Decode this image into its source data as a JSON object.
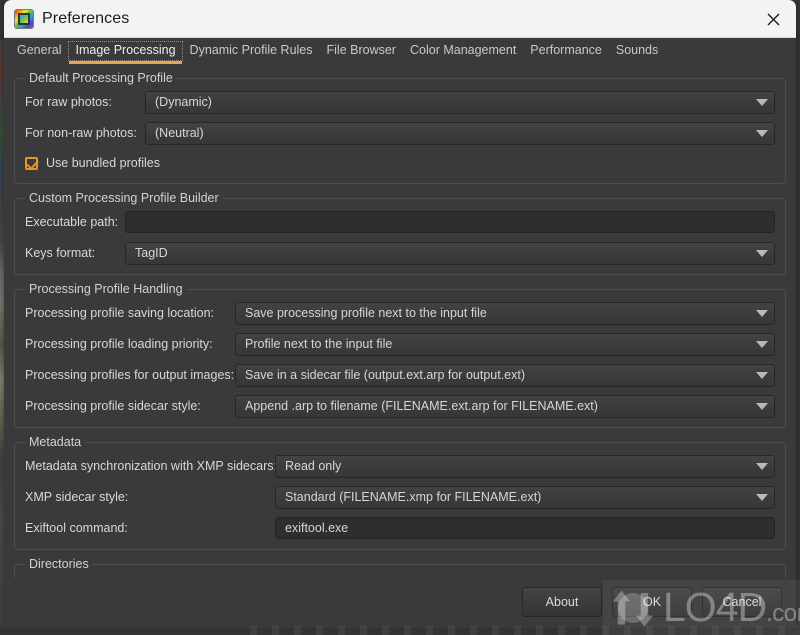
{
  "window": {
    "title": "Preferences",
    "app_icon": "rawtherapee-icon",
    "close_label": "close-icon"
  },
  "tabs": [
    {
      "label": "General",
      "active": false
    },
    {
      "label": "Image Processing",
      "active": true
    },
    {
      "label": "Dynamic Profile Rules",
      "active": false
    },
    {
      "label": "File Browser",
      "active": false
    },
    {
      "label": "Color Management",
      "active": false
    },
    {
      "label": "Performance",
      "active": false
    },
    {
      "label": "Sounds",
      "active": false
    }
  ],
  "groups": {
    "default_processing_profile": {
      "title": "Default Processing Profile",
      "raw_label": "For raw photos:",
      "raw_value": "(Dynamic)",
      "nonraw_label": "For non-raw photos:",
      "nonraw_value": "(Neutral)",
      "bundled_label": "Use bundled profiles",
      "bundled_checked": true
    },
    "custom_profile_builder": {
      "title": "Custom Processing Profile Builder",
      "exec_label": "Executable path:",
      "exec_value": "",
      "keys_label": "Keys format:",
      "keys_value": "TagID"
    },
    "profile_handling": {
      "title": "Processing Profile Handling",
      "saving_location_label": "Processing profile saving location:",
      "saving_location_value": "Save processing profile next to the input file",
      "loading_priority_label": "Processing profile loading priority:",
      "loading_priority_value": "Profile next to the input file",
      "output_images_label": "Processing profiles for output images:",
      "output_images_value": "Save in a sidecar file (output.ext.arp for output.ext)",
      "sidecar_style_label": "Processing profile sidecar style:",
      "sidecar_style_value": "Append .arp to filename (FILENAME.ext.arp for FILENAME.ext)"
    },
    "metadata": {
      "title": "Metadata",
      "sync_label": "Metadata synchronization with XMP sidecars:",
      "sync_value": "Read only",
      "xmp_style_label": "XMP sidecar style:",
      "xmp_style_value": "Standard (FILENAME.xmp for FILENAME.ext)",
      "exiftool_label": "Exiftool command:",
      "exiftool_value": "exiftool.exe"
    },
    "directories": {
      "title": "Directories"
    }
  },
  "footer": {
    "about_label": "About",
    "ok_label": "OK",
    "cancel_label": "Cancel"
  },
  "watermark": {
    "text": "LO4D",
    "suffix": ".com"
  },
  "colors": {
    "accent": "#e8922e",
    "window_bg": "#3a3a3a",
    "titlebar_bg": "#f3f3f3",
    "text": "#d8d8d8",
    "field_bg": "#3b3b3b"
  }
}
